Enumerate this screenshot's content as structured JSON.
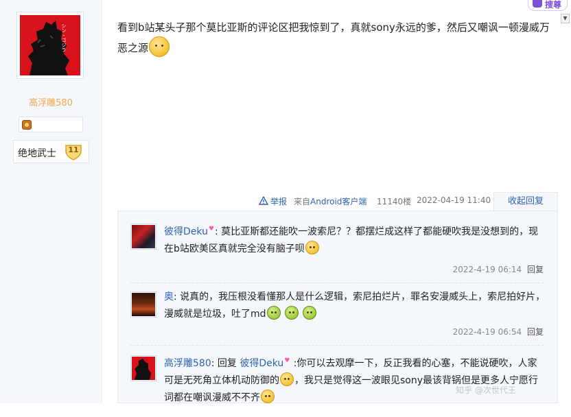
{
  "author": {
    "username": "高浮雕580",
    "level_title": "绝地武士",
    "level_number": "11"
  },
  "post": {
    "text": "看到b站某头子那个莫比亚斯的评论区把我惊到了，真就sony永远的爹，然后又嘲讽一顿漫威万恶之源",
    "report_label": "举报",
    "from_label": "来自",
    "client_label": "Android客户端",
    "floor": "11140楼",
    "time": "2022-04-19 11:40",
    "collapse_label": "收起回复"
  },
  "browser_ext": {
    "sogou_label": "搜尊"
  },
  "replies": [
    {
      "user": "彼得Deku",
      "text": "莫比亚斯都还能吹一波索尼？？都摆烂成这样了都能硬吹我是没想到的，现在b站欧美区真就完全没有脑子呗",
      "time": "2022-4-19 06:14",
      "reply_label": "回复"
    },
    {
      "user": "奥",
      "text": "说真的，我压根没看懂那人是什么逻辑，索尼拍烂片，罪名安漫威头上，索尼拍好片，漫威就是垃圾，吐了md",
      "time": "2022-4-19 06:54",
      "reply_label": "回复"
    },
    {
      "user": "高浮雕580",
      "reply_to_prefix": "回复",
      "reply_to_user": "彼得Deku",
      "text_a": "你可以去观摩一下，反正我看的心塞，不能说硬吹，人家可是无死角立体机动防御的",
      "text_b": "，我只是觉得这一波眼见sony最该背锅但是更多人宁愿行词都在嘲讽漫威不不齐"
    }
  ],
  "watermark": "知乎 @次世代王"
}
